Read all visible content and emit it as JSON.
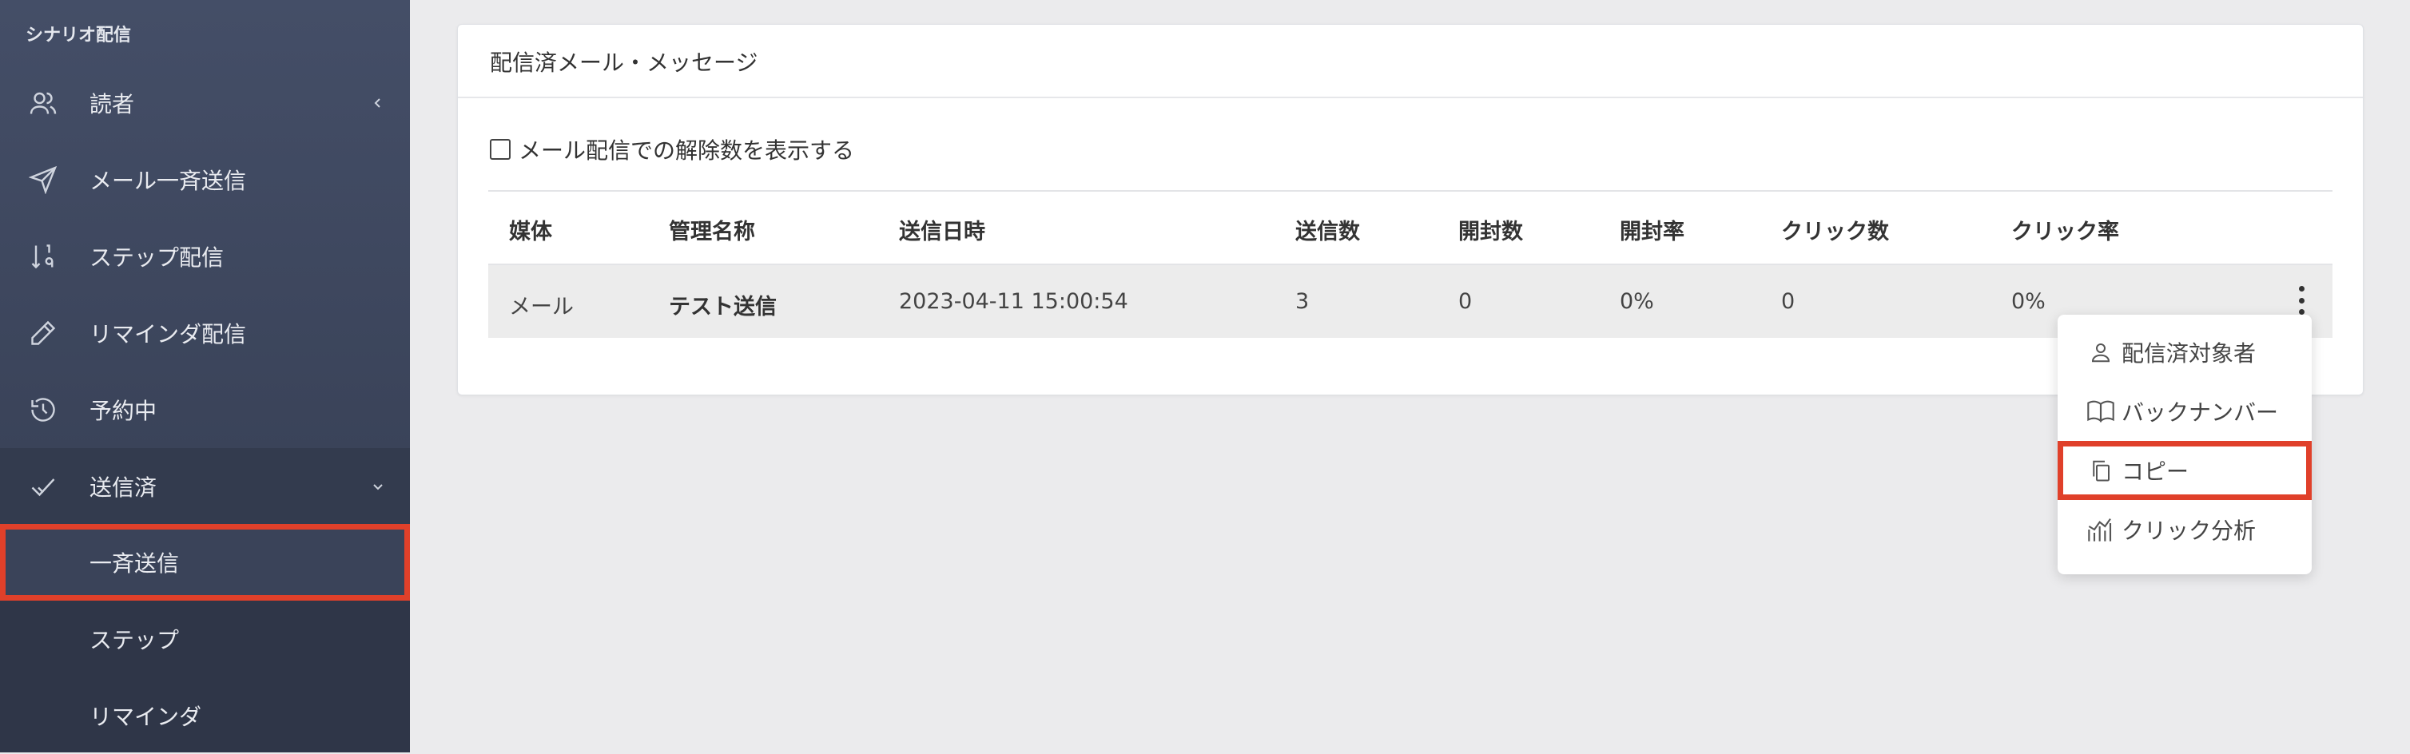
{
  "sidebar": {
    "section_title": "シナリオ配信",
    "items": [
      {
        "label": "読者",
        "icon": "users-icon",
        "chevron": "‹"
      },
      {
        "label": "メール一斉送信",
        "icon": "send-icon"
      },
      {
        "label": "ステップ配信",
        "icon": "sort-numeric-icon"
      },
      {
        "label": "リマインダ配信",
        "icon": "pencil-icon"
      },
      {
        "label": "予約中",
        "icon": "history-icon"
      },
      {
        "label": "送信済",
        "icon": "check-icon",
        "chevron": "⌄"
      }
    ],
    "sub_items": [
      {
        "label": "一斉送信"
      },
      {
        "label": "ステップ"
      },
      {
        "label": "リマインダ"
      }
    ]
  },
  "panel": {
    "title": "配信済メール・メッセージ",
    "checkbox_label": "メール配信での解除数を表示する",
    "table": {
      "headers": [
        "媒体",
        "管理名称",
        "送信日時",
        "送信数",
        "開封数",
        "開封率",
        "クリック数",
        "クリック率"
      ],
      "rows": [
        [
          "メール",
          "テスト送信",
          "2023-04-11 15:00:54",
          "3",
          "0",
          "0%",
          "0",
          "0%"
        ]
      ]
    }
  },
  "dropdown": {
    "items": [
      {
        "label": "配信済対象者",
        "icon": "user-icon"
      },
      {
        "label": "バックナンバー",
        "icon": "book-open-icon"
      },
      {
        "label": "コピー",
        "icon": "copy-icon"
      },
      {
        "label": "クリック分析",
        "icon": "chart-analytics-icon"
      }
    ]
  },
  "colors": {
    "sidebar_bg": "#3f485e",
    "highlight": "#e0402a"
  }
}
